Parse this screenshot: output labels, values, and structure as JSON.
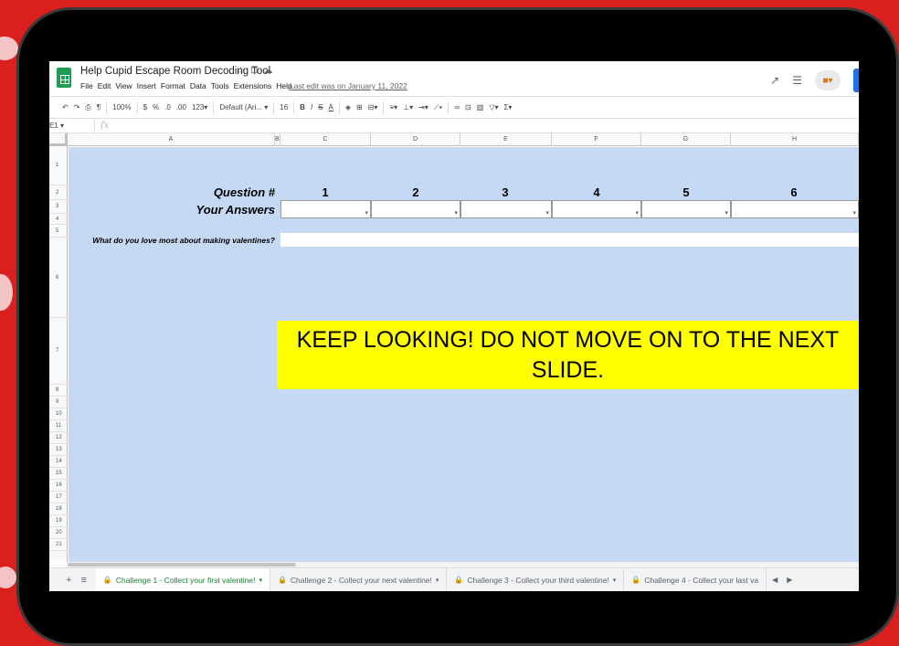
{
  "document": {
    "title": "Help Cupid Escape Room Decoding Tool",
    "last_edit": "Last edit was on January 11, 2022"
  },
  "menu": [
    "File",
    "Edit",
    "View",
    "Insert",
    "Format",
    "Data",
    "Tools",
    "Extensions",
    "Help"
  ],
  "toolbar": {
    "zoom": "100%",
    "currency": "$",
    "percent": "%",
    "dec_decrease": ".0",
    "dec_increase": ".00",
    "more_formats": "123▾",
    "font": "Default (Ari... ▾",
    "font_size": "16",
    "bold": "B",
    "italic": "I",
    "strike": "S",
    "text_color": "A"
  },
  "formula_bar": {
    "name_box": "E1",
    "fx": "fx"
  },
  "columns": [
    "A",
    "B",
    "C",
    "D",
    "E",
    "F",
    "G",
    "H"
  ],
  "rows": [
    "1",
    "2",
    "3",
    "4",
    "5",
    "6",
    "7",
    "8",
    "9",
    "10",
    "11",
    "12",
    "13",
    "14",
    "15",
    "16",
    "17",
    "18",
    "19",
    "20",
    "21"
  ],
  "sheet": {
    "question_label": "Question #",
    "answers_label": "Your Answers",
    "question_numbers": [
      "1",
      "2",
      "3",
      "4",
      "5",
      "6"
    ],
    "prompt": "What do you love most about making valentines?",
    "banner": "KEEP LOOKING! DO NOT MOVE ON TO THE NEXT SLIDE."
  },
  "tabs": [
    {
      "label": "Challenge 1 - Collect your first valentine!",
      "active": true
    },
    {
      "label": "Challenge 2 - Collect your next valentine!",
      "active": false
    },
    {
      "label": "Challenge 3 - Collect your third valentine!",
      "active": false
    },
    {
      "label": "Challenge 4 - Collect your last va",
      "active": false
    }
  ],
  "colors": {
    "background": "#d9201f",
    "sheet_fill": "#c6d9f4",
    "banner_fill": "#ffff00",
    "active_tab": "#188038"
  }
}
